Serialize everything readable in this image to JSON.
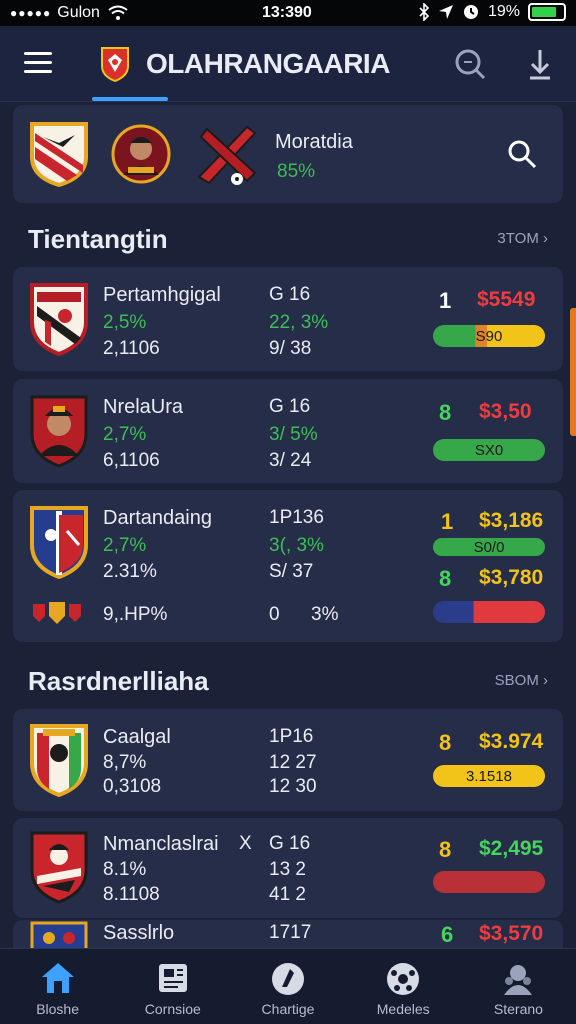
{
  "status": {
    "carrier": "Gulon",
    "time": "13:390",
    "battery": "19%"
  },
  "header": {
    "title": "OLAHRANGAARIA"
  },
  "featured": {
    "title": "Moratdia",
    "percent": "85%"
  },
  "sections": [
    {
      "title": "Tientangtin",
      "more": "3TOM"
    },
    {
      "title": "Rasrdnerlliaha",
      "more": "SBOM"
    }
  ],
  "cards": [
    {
      "name": "Pertamhgigal",
      "pct": "2,5%",
      "vol": "2,1106",
      "c1": "G 16",
      "c2": "22, 3%",
      "c3": "9/ 38",
      "rank": "1",
      "price": "$5549",
      "bar": "S90"
    },
    {
      "name": "NrelaUra",
      "pct": "2,7%",
      "vol": "6,1106",
      "c1": "G 16",
      "c2": "3/ 5%",
      "c3": "3/ 24",
      "rank": "8",
      "price": "$3,50",
      "bar": "SX0"
    },
    {
      "name": "Dartandaing",
      "pct": "2,7%",
      "vol": "2.31%",
      "c1": "1P136",
      "c2": "3(, 3%",
      "c3": "S/ 37",
      "rank": "1",
      "price": "$3,186",
      "bar": "S0/0",
      "rank2": "8",
      "price2": "$3,780",
      "extra": "9,.HP%",
      "extra_c1": "0",
      "extra_c2": "3%"
    },
    {
      "name": "Caalgal",
      "pct": "8,7%",
      "vol": "0,3108",
      "c1": "1P16",
      "c2": "12 27",
      "c3": "12 30",
      "rank": "8",
      "price": "$3.974",
      "bar": "3.1518"
    },
    {
      "name": "Nmanclaslrai",
      "mark": "X",
      "pct": "8.1%",
      "vol": "8.1108",
      "c1": "G 16",
      "c2": "13 2",
      "c3": "41 2",
      "rank": "8",
      "price": "$2,495",
      "bar": ""
    },
    {
      "name": "Sasslrlo",
      "c1": "1717",
      "rank": "6",
      "price": "$3,570"
    }
  ],
  "nav": [
    {
      "label": "Bloshe",
      "icon": "home-icon"
    },
    {
      "label": "Cornsioe",
      "icon": "news-icon"
    },
    {
      "label": "Chartige",
      "icon": "chart-icon"
    },
    {
      "label": "Medeles",
      "icon": "ball-icon"
    },
    {
      "label": "Sterano",
      "icon": "profile-icon"
    }
  ],
  "colors": {
    "accent": "#3ea0ff",
    "positive": "#3dbf56",
    "negative": "#e0393e",
    "gold": "#f2c318"
  }
}
